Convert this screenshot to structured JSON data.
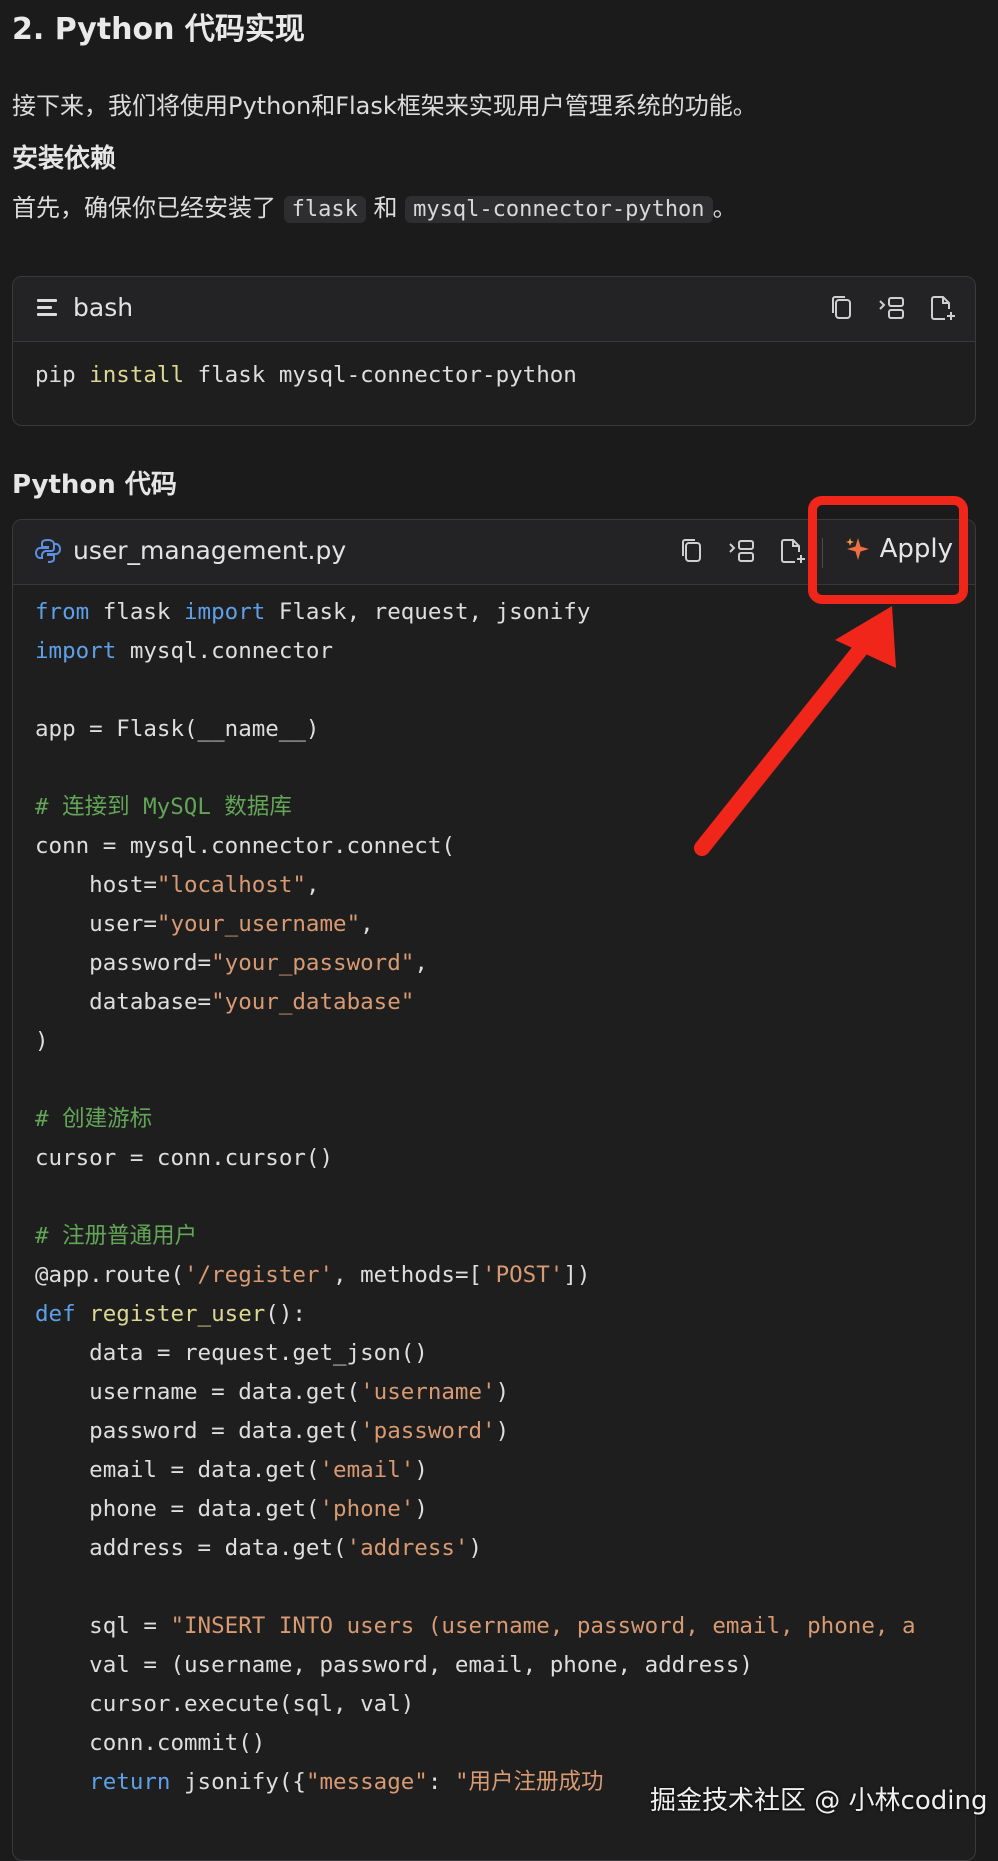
{
  "section_title": "2. Python 代码实现",
  "intro": "接下来，我们将使用Python和Flask框架来实现用户管理系统的功能。",
  "install_heading": "安装依赖",
  "install_text_prefix": "首先，确保你已经安装了",
  "install_chip1": "flask",
  "install_and": "和",
  "install_chip2": "mysql-connector-python",
  "install_text_suffix": "。",
  "bash_block": {
    "lang": "bash",
    "icon": "lines-icon",
    "toolbar_icons": [
      "copy-icon",
      "insert-icon",
      "new-file-icon"
    ],
    "code_cmd": "pip",
    "code_kw": "install",
    "code_rest": " flask mysql-connector-python"
  },
  "python_heading": "Python 代码",
  "py_block": {
    "filename": "user_management.py",
    "icon": "python-icon",
    "toolbar_icons": [
      "copy-icon",
      "insert-icon",
      "new-file-icon"
    ],
    "apply_label": "Apply",
    "apply_icon": "sparkle-icon"
  },
  "watermark": "掘金技术社区 @ 小林coding",
  "colors": {
    "highlight": "#f1261a",
    "keyword": "#5ea0e8",
    "string": "#d89a72",
    "comment": "#62a557"
  }
}
